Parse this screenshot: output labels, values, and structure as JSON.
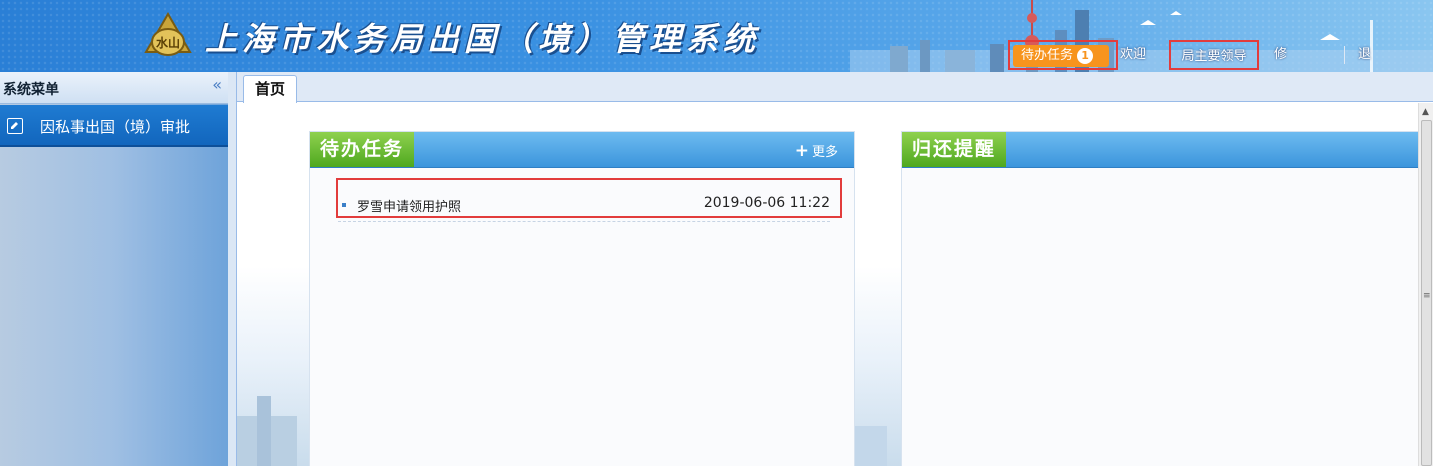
{
  "header": {
    "title": "上海市水务局出国（境）管理系统",
    "logo_text": "水山",
    "todo_label": "待办任务",
    "todo_count": "1",
    "welcome": "欢迎您：",
    "user": "局主要领导",
    "change_password": "修改密码",
    "logout": "退出系统"
  },
  "sidebar": {
    "title": "系统菜单",
    "collapse_icon": "«",
    "items": [
      {
        "label": "因私事出国（境）审批",
        "icon": "edit-icon"
      }
    ]
  },
  "tabs": [
    {
      "label": "首页",
      "active": true
    }
  ],
  "panels": {
    "todo": {
      "title": "待办任务",
      "more": "更多",
      "tasks": [
        {
          "name": "罗雪申请领用护照",
          "time": "2019-06-06 11:22"
        }
      ]
    },
    "return_reminder": {
      "title": "归还提醒"
    }
  },
  "colors": {
    "header_blue": "#2a7fd6",
    "menu_blue": "#1266bd",
    "panel_green": "#4ea81f",
    "badge_orange": "#f7941d",
    "highlight_red": "#e23c3c"
  }
}
